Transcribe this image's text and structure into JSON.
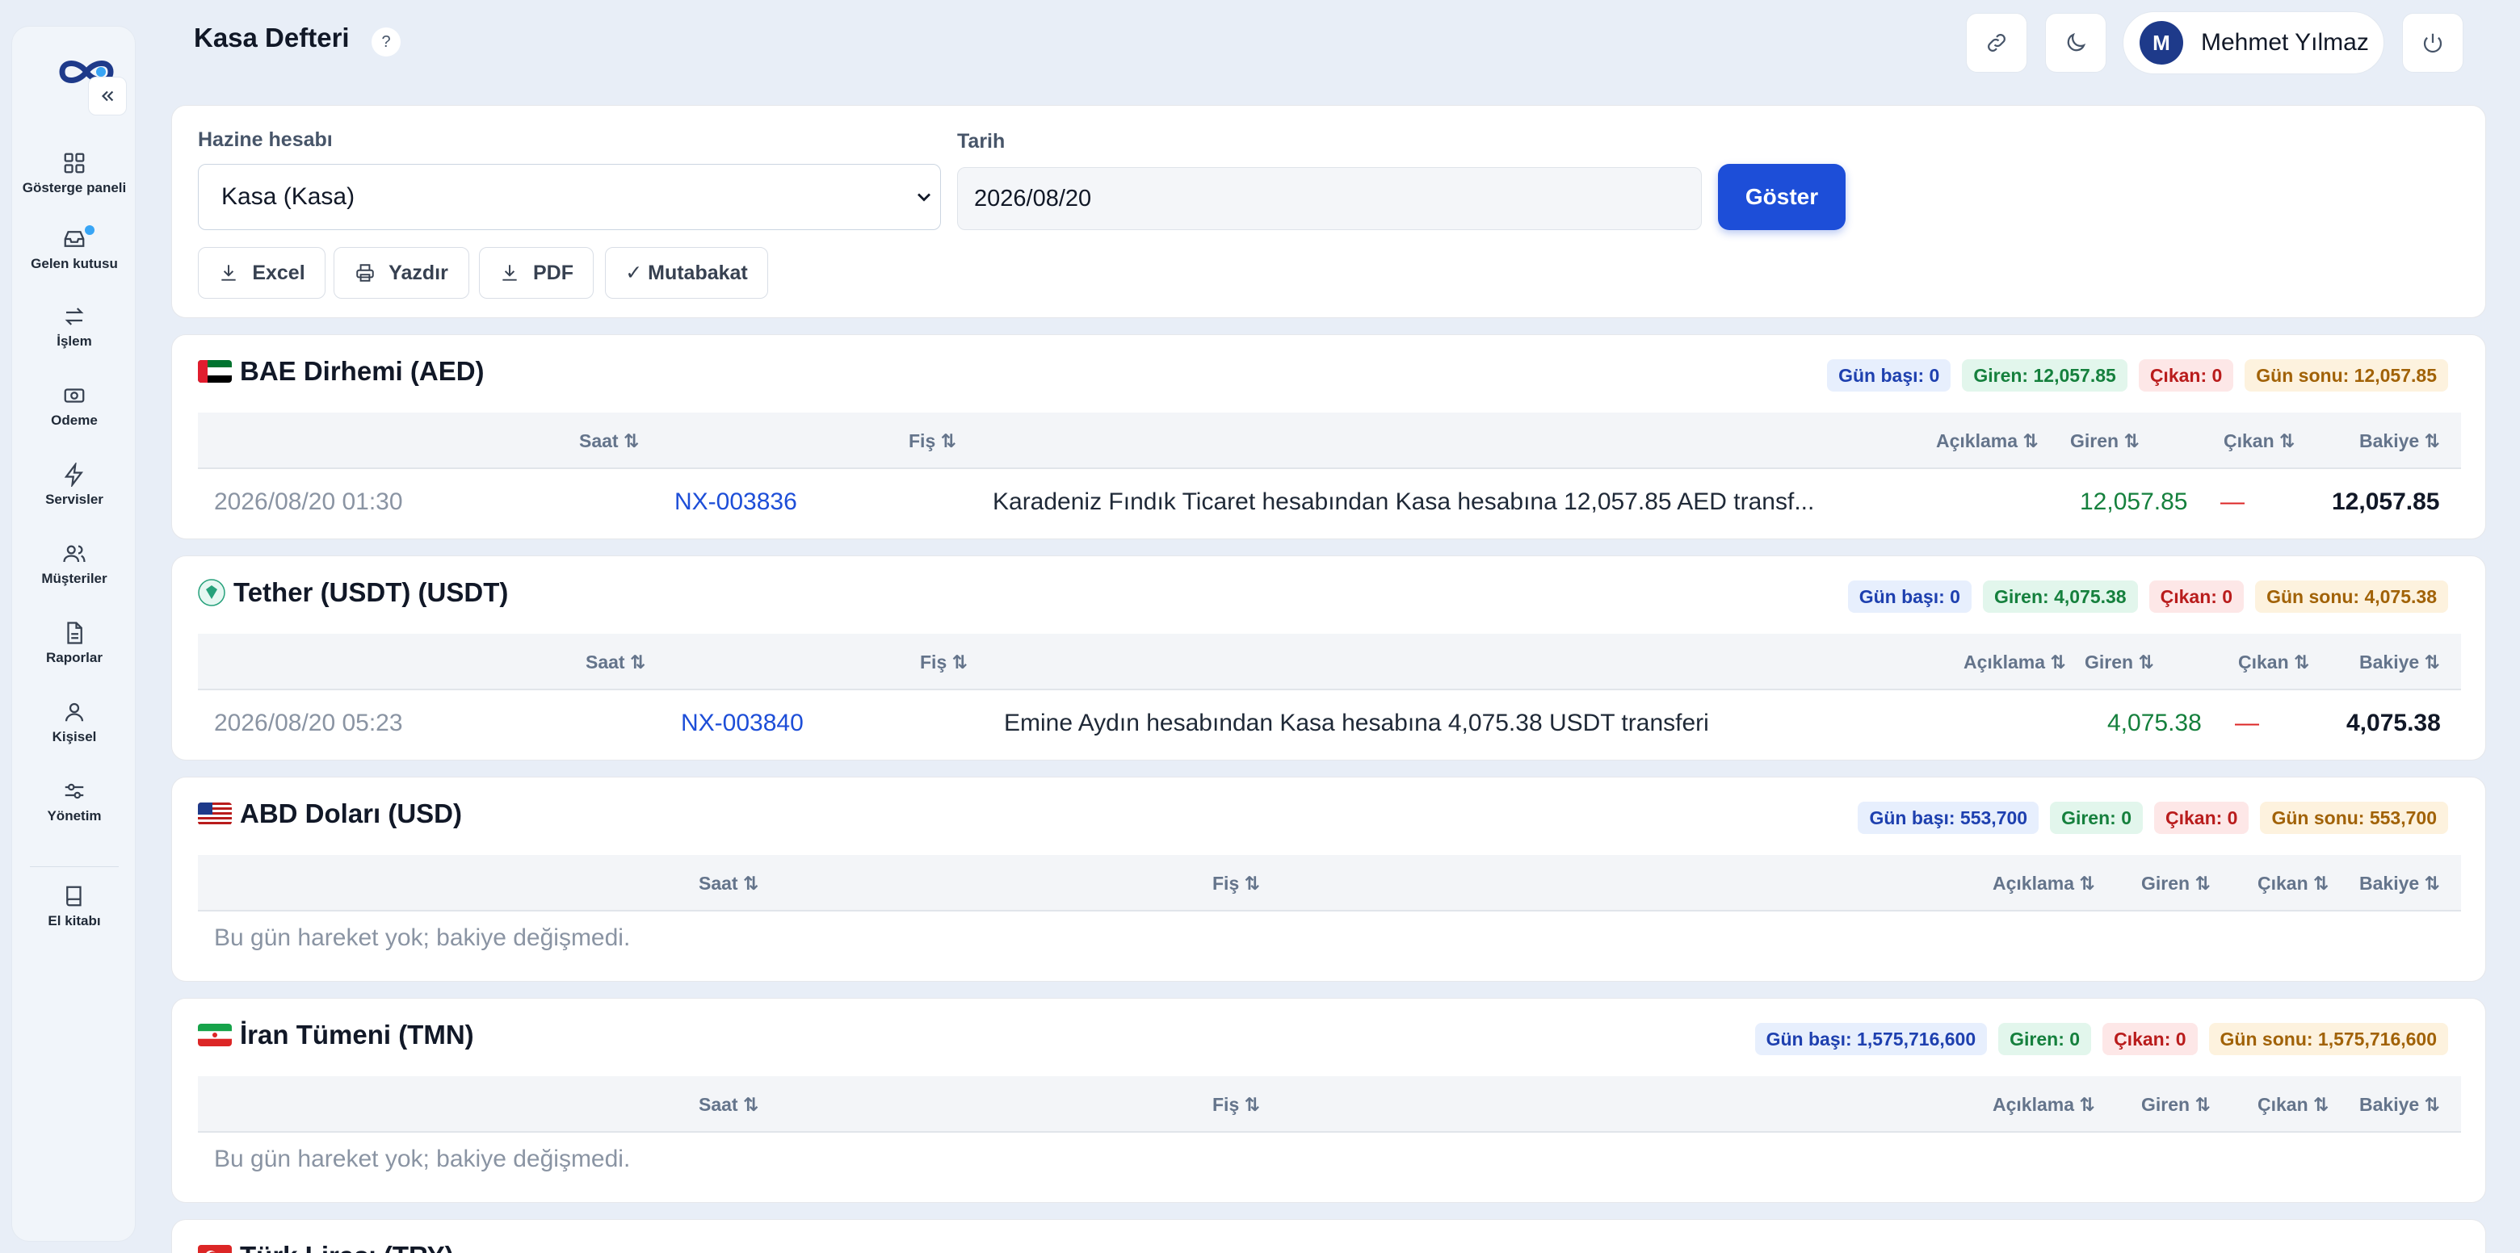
{
  "app": {
    "page_title": "Kasa Defteri"
  },
  "sidebar": {
    "items": [
      {
        "label": "Gösterge paneli",
        "icon": "grid-icon"
      },
      {
        "label": "Gelen kutusu",
        "icon": "inbox-icon"
      },
      {
        "label": "İşlem",
        "icon": "arrows-icon"
      },
      {
        "label": "Odeme",
        "icon": "cash-icon"
      },
      {
        "label": "Servisler",
        "icon": "lightning-icon"
      },
      {
        "label": "Müşteriler",
        "icon": "users-icon"
      },
      {
        "label": "Raporlar",
        "icon": "document-icon"
      },
      {
        "label": "Kişisel",
        "icon": "person-icon"
      },
      {
        "label": "Yönetim",
        "icon": "sliders-icon"
      },
      {
        "label": "El kitabı",
        "icon": "book-icon"
      }
    ]
  },
  "header": {
    "help": "?",
    "user": {
      "initial": "M",
      "name": "Mehmet Yılmaz"
    }
  },
  "filters": {
    "account_label": "Hazine hesabı",
    "account_value": "Kasa (Kasa)",
    "date_label": "Tarih",
    "date_value": "2026/08/20",
    "show_button": "Göster",
    "tools": {
      "excel": "Excel",
      "print": "Yazdır",
      "pdf": "PDF",
      "reconcile": "✓ Mutabakat"
    }
  },
  "columns": {
    "time": "Saat ⇅",
    "fis": "Fiş ⇅",
    "desc": "Açıklama ⇅",
    "in": "Giren ⇅",
    "out": "Çıkan ⇅",
    "balance": "Bakiye ⇅"
  },
  "sections": [
    {
      "title": "BAE Dirhemi (AED)",
      "badges": {
        "start": "Gün başı: 0",
        "in": "Giren: 12,057.85",
        "out": "Çıkan: 0",
        "end": "Gün sonu: 12,057.85"
      },
      "rows": [
        {
          "time": "2026/08/20 01:30",
          "fis": "NX-003836",
          "desc": "Karadeniz Fındık Ticaret hesabından Kasa hesabına 12,057.85 AED transf...",
          "in": "12,057.85",
          "out": "—",
          "balance": "12,057.85"
        }
      ]
    },
    {
      "title": "Tether (USDT) (USDT)",
      "badges": {
        "start": "Gün başı: 0",
        "in": "Giren: 4,075.38",
        "out": "Çıkan: 0",
        "end": "Gün sonu: 4,075.38"
      },
      "rows": [
        {
          "time": "2026/08/20 05:23",
          "fis": "NX-003840",
          "desc": "Emine Aydın hesabından Kasa hesabına 4,075.38 USDT transferi",
          "in": "4,075.38",
          "out": "—",
          "balance": "4,075.38"
        }
      ]
    },
    {
      "title": "ABD Doları (USD)",
      "badges": {
        "start": "Gün başı: 553,700",
        "in": "Giren: 0",
        "out": "Çıkan: 0",
        "end": "Gün sonu: 553,700"
      },
      "empty": "Bu gün hareket yok; bakiye değişmedi."
    },
    {
      "title": "İran Tümeni (TMN)",
      "badges": {
        "start": "Gün başı: 1,575,716,600",
        "in": "Giren: 0",
        "out": "Çıkan: 0",
        "end": "Gün sonu: 1,575,716,600"
      },
      "empty": "Bu gün hareket yok; bakiye değişmedi."
    },
    {
      "title": "Türk Lirası (TRY)"
    }
  ]
}
